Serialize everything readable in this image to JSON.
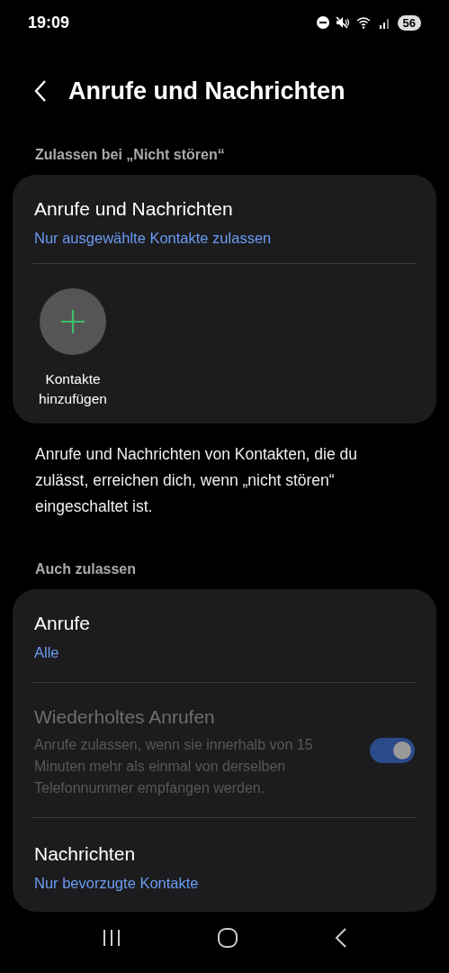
{
  "status_bar": {
    "time": "19:09",
    "battery": "56"
  },
  "header": {
    "title": "Anrufe und Nachrichten"
  },
  "section1": {
    "label": "Zulassen bei „Nicht stören“",
    "card": {
      "title": "Anrufe und Nachrichten",
      "subtitle": "Nur ausgewählte Kontakte zulassen",
      "add_label": "Kontakte hinzufügen"
    }
  },
  "description": "Anrufe und Nachrichten von Kontakten, die du zulässt, erreichen dich, wenn „nicht stören“ eingeschaltet ist.",
  "section2": {
    "label": "Auch zulassen",
    "items": [
      {
        "kind": "link",
        "title": "Anrufe",
        "subtitle": "Alle"
      },
      {
        "kind": "toggle",
        "title": "Wiederholtes Anrufen",
        "subtitle": "Anrufe zulassen, wenn sie innerhalb von 15 Minuten mehr als einmal von derselben Telefonnummer empfangen werden.",
        "on": true,
        "disabled": true
      },
      {
        "kind": "link",
        "title": "Nachrichten",
        "subtitle": "Nur bevorzugte Kontakte"
      }
    ]
  }
}
